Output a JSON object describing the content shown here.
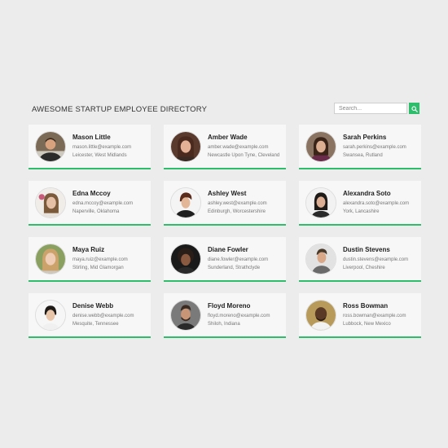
{
  "header": {
    "title": "AWESOME STARTUP EMPLOYEE DIRECTORY",
    "search_placeholder": "Search...",
    "accent": "#2ebd6b"
  },
  "employees": [
    {
      "name": "Mason Little",
      "email": "mason.little@example.com",
      "location": "Leicester, West Midlands"
    },
    {
      "name": "Amber Wade",
      "email": "amber.wade@example.com",
      "location": "Newcastle Upon Tyne, Cleveland"
    },
    {
      "name": "Sarah Perkins",
      "email": "sarah.perkins@example.com",
      "location": "Swansea, Rutland"
    },
    {
      "name": "Edna Mccoy",
      "email": "edna.mccoy@example.com",
      "location": "Naperville, Oklahoma"
    },
    {
      "name": "Ashley West",
      "email": "ashley.west@example.com",
      "location": "Edinburgh, Worcestershire"
    },
    {
      "name": "Alexandra Soto",
      "email": "alexandra.soto@example.com",
      "location": "York, Lancashire"
    },
    {
      "name": "Maya Ruiz",
      "email": "maya.ruiz@example.com",
      "location": "Stirling, Mid Glamorgan"
    },
    {
      "name": "Diane Fowler",
      "email": "diane.fowler@example.com",
      "location": "Sunderland, Strathclyde"
    },
    {
      "name": "Dustin Stevens",
      "email": "dustin.stevens@example.com",
      "location": "Liverpool, Cheshire"
    },
    {
      "name": "Denise Webb",
      "email": "denise.webb@example.com",
      "location": "Mesquite, Tennessee"
    },
    {
      "name": "Floyd Moreno",
      "email": "floyd.moreno@example.com",
      "location": "Shiloh, Indiana"
    },
    {
      "name": "Ross Bowman",
      "email": "ross.bowman@example.com",
      "location": "Lubbock, New Mexico"
    }
  ]
}
